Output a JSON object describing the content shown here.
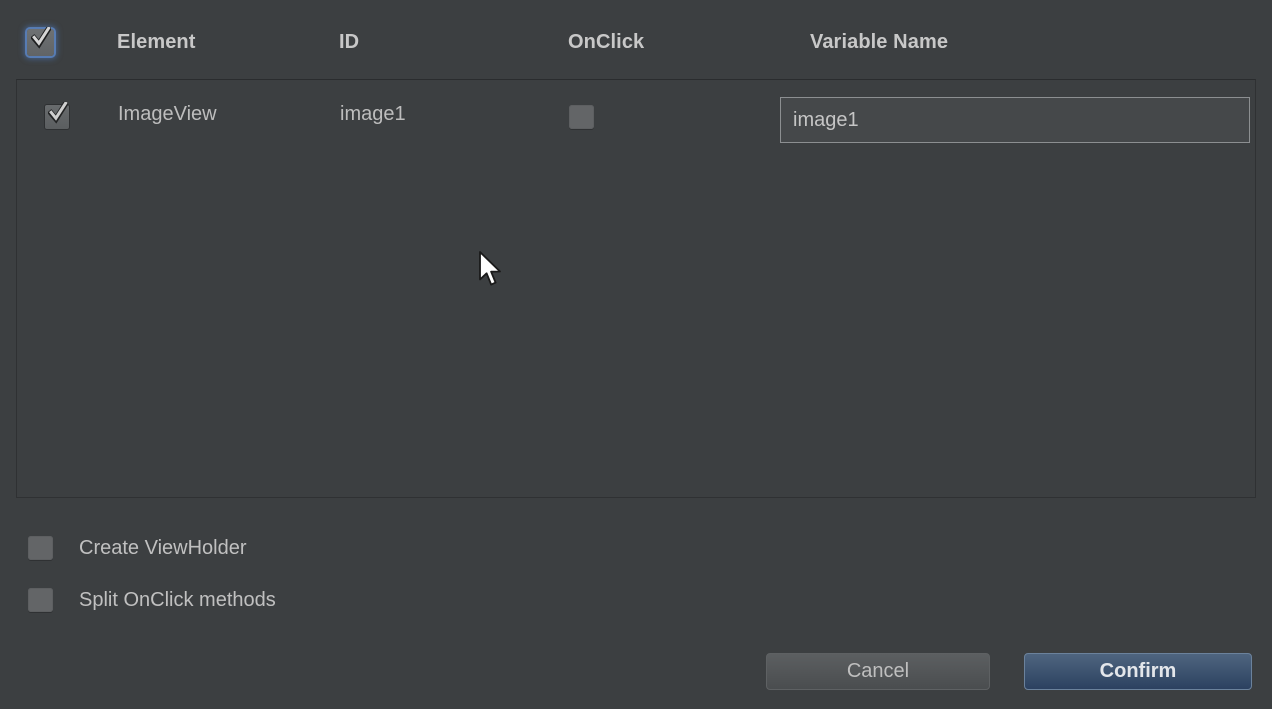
{
  "table": {
    "columns": [
      {
        "key": "select",
        "label": ""
      },
      {
        "key": "element",
        "label": "Element"
      },
      {
        "key": "id",
        "label": "ID"
      },
      {
        "key": "onclick",
        "label": "OnClick"
      },
      {
        "key": "variable",
        "label": "Variable Name"
      }
    ],
    "header": {
      "select_all_checked": true,
      "element_label": "Element",
      "id_label": "ID",
      "onclick_label": "OnClick",
      "variable_label": "Variable Name"
    },
    "rows": [
      {
        "selected": true,
        "element": "ImageView",
        "id": "image1",
        "onclick": false,
        "variable_value": "image1",
        "variable_placeholder": "image1"
      }
    ]
  },
  "options": [
    {
      "label": "Create ViewHolder",
      "checked": false
    },
    {
      "label": "Split OnClick methods",
      "checked": false
    }
  ],
  "buttons": {
    "cancel": "Cancel",
    "confirm": "Confirm"
  },
  "icons": {
    "checkmark": "check-icon",
    "cursor": "mouse-pointer-icon"
  },
  "colors": {
    "background": "#3c3f41",
    "text": "#bdbdbd",
    "header_text": "#c8c8c8",
    "accent_blue": "#4f657f",
    "confirm_border": "#6b829c",
    "focus_glow": "#5a82be",
    "checkbox_fill": "#636567",
    "input_border": "#8c8f91",
    "table_border": "#2f3133"
  }
}
